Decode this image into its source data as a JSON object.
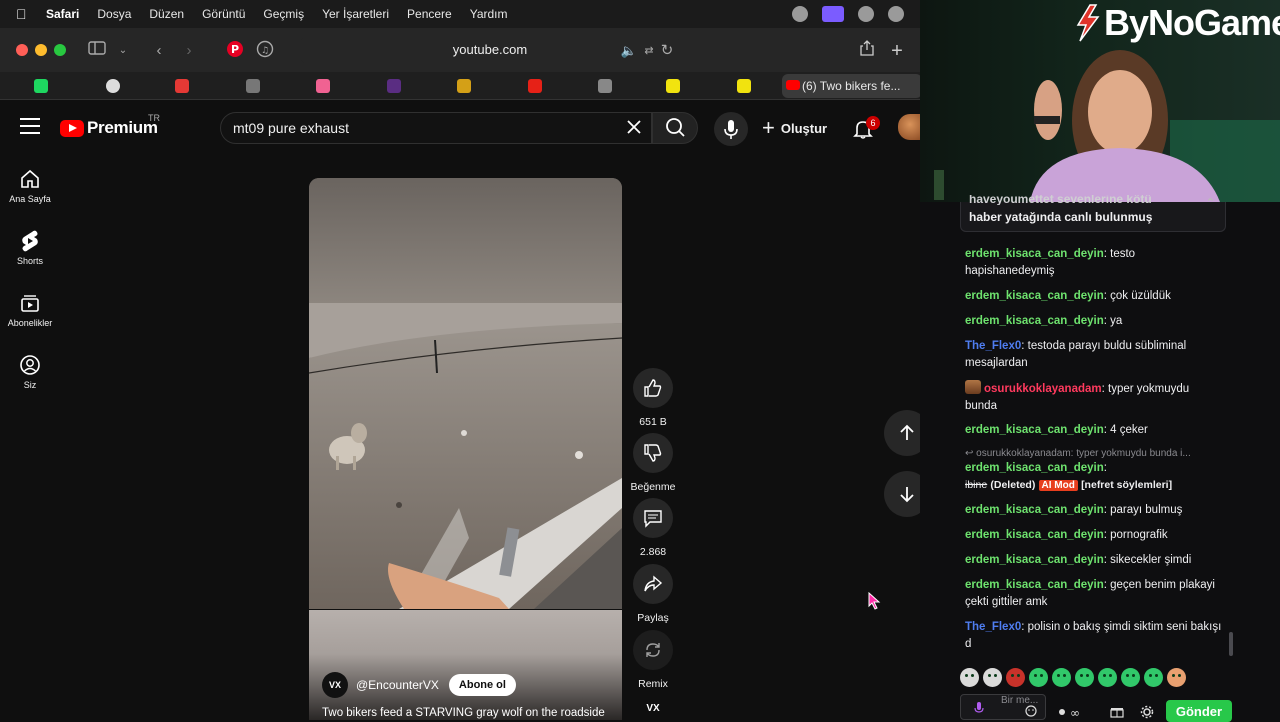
{
  "menubar": {
    "items": [
      "Safari",
      "Dosya",
      "Düzen",
      "Görüntü",
      "Geçmiş",
      "Yer İşaretleri",
      "Pencere",
      "Yardım"
    ]
  },
  "browser": {
    "url": "youtube.com",
    "active_tab_title": "(6) Two bikers fe..."
  },
  "youtube": {
    "logo_text": "Premium",
    "country_code": "TR",
    "search_query": "mt09 pure exhaust",
    "create_label": "Oluştur",
    "notification_count": "6",
    "nav": [
      {
        "label": "Ana Sayfa",
        "icon": "home-icon"
      },
      {
        "label": "Shorts",
        "icon": "shorts-icon"
      },
      {
        "label": "Abonelikler",
        "icon": "subscriptions-icon"
      },
      {
        "label": "Siz",
        "icon": "you-icon"
      }
    ],
    "actions": {
      "like_count": "651 B",
      "dislike_label": "Beğenme",
      "comment_count": "2.868",
      "share_label": "Paylaş",
      "remix_label": "Remix"
    },
    "channel_avatar_text": "VX",
    "channel_name": "@EncounterVX",
    "subscribe_label": "Abone ol",
    "video_title": "Two bikers feed a STARVING gray wolf on the roadside"
  },
  "stream": {
    "brand": "ByNoGame",
    "pinned_message": "haber yatağında canlı bulunmuş",
    "pinned_message_partial": "haveyoumettet sevenlerine kötü",
    "messages": [
      {
        "user": "erdem_kisaca_can_deyin",
        "color": "#6ee26e",
        "text": "testo hapishanedeymiş"
      },
      {
        "user": "erdem_kisaca_can_deyin",
        "color": "#6ee26e",
        "text": "çok üzüldük"
      },
      {
        "user": "erdem_kisaca_can_deyin",
        "color": "#6ee26e",
        "text": "ya"
      },
      {
        "user": "The_Flex0",
        "color": "#4f7df0",
        "text": "testoda parayı buldu sübliminal mesajlardan"
      },
      {
        "user": "osurukkoklayanadam",
        "color": "#ff3a5e",
        "text": "typer yokmuydu bunda"
      },
      {
        "user": "erdem_kisaca_can_deyin",
        "color": "#6ee26e",
        "text": "4 çeker"
      },
      {
        "user": "erdem_kisaca_can_deyin",
        "color": "#6ee26e",
        "text": "parayı bulmuş"
      },
      {
        "user": "erdem_kisaca_can_deyin",
        "color": "#6ee26e",
        "text": "pornografik"
      },
      {
        "user": "erdem_kisaca_can_deyin",
        "color": "#6ee26e",
        "text": "sikecekler şimdi"
      },
      {
        "user": "erdem_kisaca_can_deyin",
        "color": "#6ee26e",
        "text": "geçen benim plakayi çekti gitti̇ler amk"
      },
      {
        "user": "The_Flex0",
        "color": "#4f7df0",
        "text": "polisin o bakış şimdi siktim seni bakışı d"
      }
    ],
    "reply_context": "osurukkoklayanadam: typer yokmuydu bunda i...",
    "deleted_message": {
      "user": "erdem_kisaca_can_deyin",
      "struck_text": "ibine",
      "deleted_label": "(Deleted)",
      "mod_badge": "AI Mod",
      "reason": "[nefret söylemleri]"
    },
    "chat_placeholder": "Bir me...",
    "send_label": "Gönder"
  }
}
